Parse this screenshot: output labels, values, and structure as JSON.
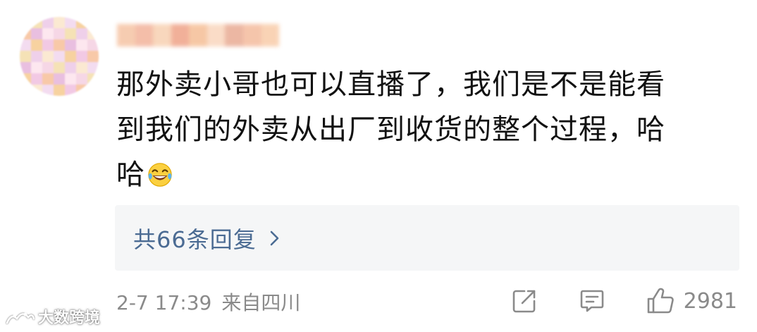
{
  "comment": {
    "lines": [
      "那外卖小哥也可以直播了，我们是不是能看",
      "到我们的外卖从出厂到收货的整个过程，哈",
      "哈"
    ],
    "emoji": "laughing-tears-emoji"
  },
  "replies": {
    "label": "共66条回复",
    "icon": "chevron-right-icon",
    "color": "#4b6b93"
  },
  "meta": {
    "timestamp": "2-7 17:39",
    "source": "来自四川"
  },
  "actions": {
    "share_icon": "share-icon",
    "comment_icon": "comment-icon",
    "like_icon": "thumbs-up-icon",
    "like_count": "2981"
  },
  "watermark": {
    "text": "大数跨境"
  }
}
